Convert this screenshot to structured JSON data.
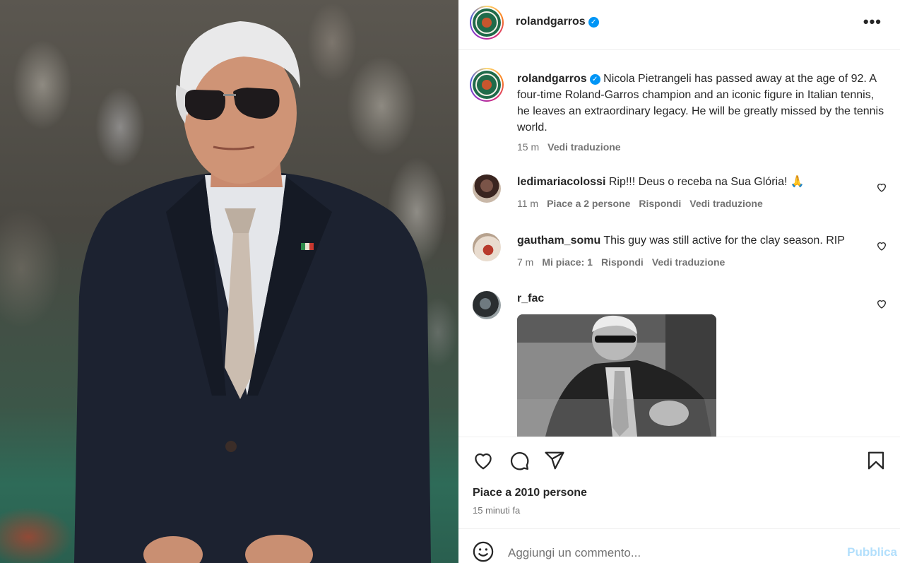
{
  "post": {
    "account": "rolandgarros",
    "caption": "Nicola Pietrangeli has passed away at the age of 92. A four-time Roland-Garros champion and an iconic figure in Italian tennis, he leaves an extraordinary legacy. He will be greatly missed by the tennis world.",
    "caption_time": "15 m",
    "see_translation": "Vedi traduzione"
  },
  "comments": [
    {
      "user": "ledimariacolossi",
      "text": "Rip!!! Deus o receba na Sua Glória! 🙏",
      "time": "11 m",
      "likes": "Piace a 2 persone",
      "reply": "Rispondi",
      "translate": "Vedi traduzione"
    },
    {
      "user": "gautham_somu",
      "text": "This guy was still active for the clay season. RIP",
      "time": "7 m",
      "likes": "Mi piace: 1",
      "reply": "Rispondi",
      "translate": "Vedi traduzione"
    },
    {
      "user": "r_fac",
      "text": ""
    }
  ],
  "footer": {
    "likes": "Piace a 2010 persone",
    "time_ago": "15 minuti fa",
    "comment_placeholder": "Aggiungi un commento...",
    "publish": "Pubblica"
  },
  "icons": {
    "more": "more-options-icon",
    "verified": "verified-badge-icon",
    "like": "heart-icon",
    "comment": "comment-icon",
    "share": "share-icon",
    "save": "bookmark-icon",
    "emoji": "emoji-icon"
  },
  "colors": {
    "verified": "#0095f6",
    "publish_disabled": "#b2dffc",
    "secondary_text": "#737373"
  }
}
